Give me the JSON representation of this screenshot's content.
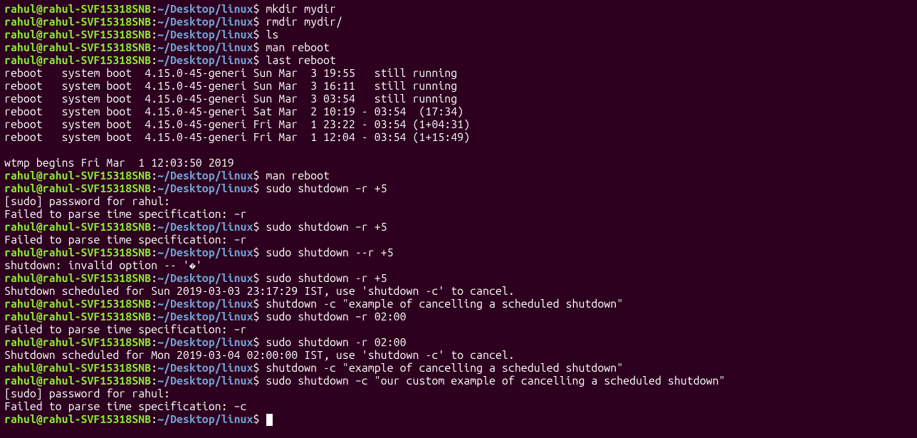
{
  "prompt": {
    "user": "rahul",
    "host": "rahul-SVF15318SNB",
    "path": "~/Desktop/linux",
    "sep": "$"
  },
  "lines": [
    {
      "type": "prompt",
      "cmd": "mkdir mydir"
    },
    {
      "type": "prompt",
      "cmd": "rmdir mydir/"
    },
    {
      "type": "prompt",
      "cmd": "ls"
    },
    {
      "type": "prompt",
      "cmd": "man reboot"
    },
    {
      "type": "prompt",
      "cmd": "last reboot"
    },
    {
      "type": "output",
      "text": "reboot   system boot  4.15.0-45-generi Sun Mar  3 19:55   still running"
    },
    {
      "type": "output",
      "text": "reboot   system boot  4.15.0-45-generi Sun Mar  3 16:11   still running"
    },
    {
      "type": "output",
      "text": "reboot   system boot  4.15.0-45-generi Sun Mar  3 03:54   still running"
    },
    {
      "type": "output",
      "text": "reboot   system boot  4.15.0-45-generi Sat Mar  2 10:19 - 03:54  (17:34)"
    },
    {
      "type": "output",
      "text": "reboot   system boot  4.15.0-45-generi Fri Mar  1 23:22 - 03:54 (1+04:31)"
    },
    {
      "type": "output",
      "text": "reboot   system boot  4.15.0-45-generi Fri Mar  1 12:04 - 03:54 (1+15:49)"
    },
    {
      "type": "blank"
    },
    {
      "type": "output",
      "text": "wtmp begins Fri Mar  1 12:03:50 2019"
    },
    {
      "type": "prompt",
      "cmd": "man reboot"
    },
    {
      "type": "prompt",
      "cmd": "sudo shutdown –r +5"
    },
    {
      "type": "output",
      "text": "[sudo] password for rahul: "
    },
    {
      "type": "output",
      "text": "Failed to parse time specification: –r"
    },
    {
      "type": "prompt",
      "cmd": "sudo shutdown –r +5"
    },
    {
      "type": "output",
      "text": "Failed to parse time specification: –r"
    },
    {
      "type": "prompt",
      "cmd": "sudo shutdown --r +5"
    },
    {
      "type": "output",
      "text": "shutdown: invalid option -- '�'"
    },
    {
      "type": "prompt",
      "cmd": "sudo shutdown -r +5"
    },
    {
      "type": "output",
      "text": "Shutdown scheduled for Sun 2019-03-03 23:17:29 IST, use 'shutdown -c' to cancel."
    },
    {
      "type": "prompt",
      "cmd": "shutdown -c \"example of cancelling a scheduled shutdown\""
    },
    {
      "type": "prompt",
      "cmd": "sudo shutdown –r 02:00"
    },
    {
      "type": "output",
      "text": "Failed to parse time specification: –r"
    },
    {
      "type": "prompt",
      "cmd": "sudo shutdown -r 02:00"
    },
    {
      "type": "output",
      "text": "Shutdown scheduled for Mon 2019-03-04 02:00:00 IST, use 'shutdown -c' to cancel."
    },
    {
      "type": "prompt",
      "cmd": "shutdown -c \"example of cancelling a scheduled shutdown\""
    },
    {
      "type": "prompt",
      "cmd": "sudo shutdown –c \"our custom example of cancelling a scheduled shutdown\""
    },
    {
      "type": "output",
      "text": "[sudo] password for rahul: "
    },
    {
      "type": "output",
      "text": "Failed to parse time specification: –c"
    },
    {
      "type": "prompt",
      "cmd": "",
      "cursor": true
    }
  ]
}
